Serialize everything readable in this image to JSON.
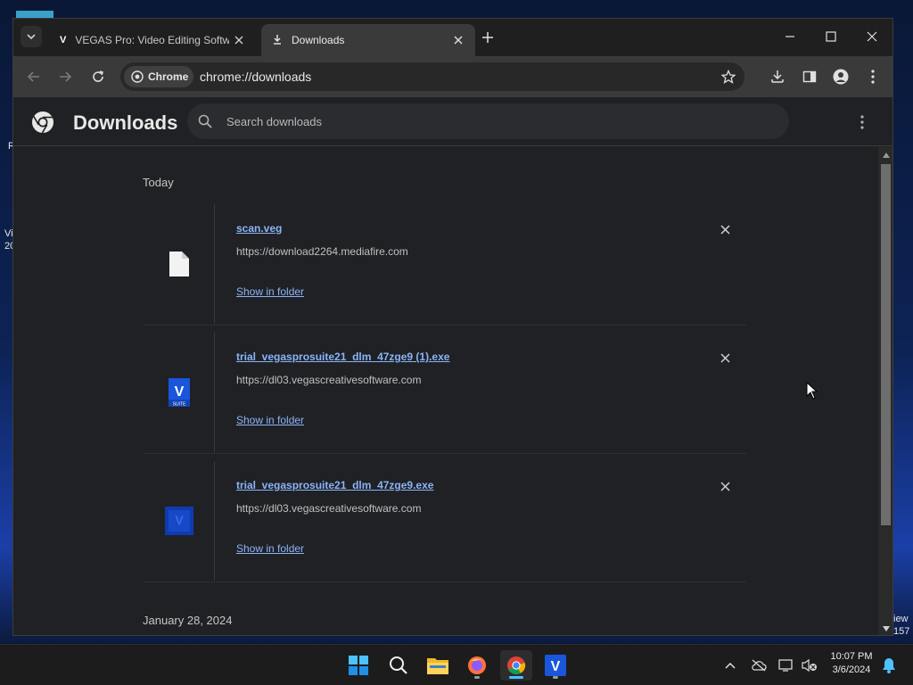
{
  "desktop": {
    "left_labels": [
      "R",
      "Vi",
      "20"
    ],
    "right_labels": [
      "iew",
      "157"
    ]
  },
  "browser": {
    "tabs": [
      {
        "title": "VEGAS Pro: Video Editing Softw",
        "icon": "vegas-v-icon",
        "active": false
      },
      {
        "title": "Downloads",
        "icon": "download-icon",
        "active": true
      }
    ],
    "omnibox": {
      "chip_label": "Chrome",
      "url": "chrome://downloads"
    }
  },
  "downloads_page": {
    "title": "Downloads",
    "search_placeholder": "Search downloads",
    "sections": [
      {
        "label": "Today",
        "items": [
          {
            "file_name": "scan.veg",
            "url": "https://download2264.mediafire.com",
            "action": "Show in folder",
            "icon": "file-icon"
          },
          {
            "file_name": "trial_vegasprosuite21_dlm_47zge9 (1).exe",
            "url": "https://dl03.vegascreativesoftware.com",
            "action": "Show in folder",
            "icon": "vegas-suite-icon"
          },
          {
            "file_name": "trial_vegasprosuite21_dlm_47zge9.exe",
            "url": "https://dl03.vegascreativesoftware.com",
            "action": "Show in folder",
            "icon": "vegas-suite-icon"
          }
        ]
      },
      {
        "label": "January 28, 2024",
        "items": []
      }
    ]
  },
  "taskbar": {
    "apps": [
      "windows-start-icon",
      "search-icon",
      "file-explorer-icon",
      "firefox-icon",
      "chrome-icon",
      "vegas-icon"
    ],
    "clock": {
      "time": "10:07 PM",
      "date": "3/6/2024"
    }
  },
  "colors": {
    "link": "#8ab4f8",
    "page_bg": "#202124",
    "toolbar_bg": "#3a3a3a",
    "vegas_blue": "#1a56db"
  }
}
